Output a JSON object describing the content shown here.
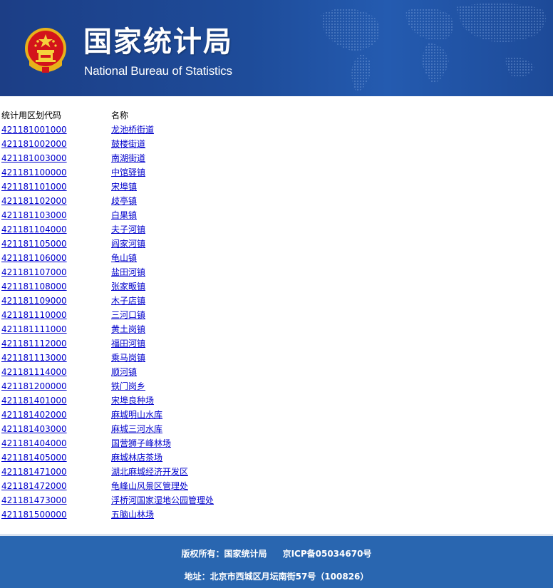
{
  "header": {
    "title_cn": "国家统计局",
    "title_en": "National Bureau of Statistics",
    "emblem_icon": "national-emblem-icon",
    "background_color": "#1e4c9a"
  },
  "table": {
    "code_header": "统计用区划代码",
    "name_header": "名称",
    "link_color": "#0000cc",
    "rows": [
      {
        "code": "421181001000",
        "name": "龙池桥街道"
      },
      {
        "code": "421181002000",
        "name": "鼓楼街道"
      },
      {
        "code": "421181003000",
        "name": "南湖街道"
      },
      {
        "code": "421181100000",
        "name": "中馆驿镇"
      },
      {
        "code": "421181101000",
        "name": "宋埠镇"
      },
      {
        "code": "421181102000",
        "name": "歧亭镇"
      },
      {
        "code": "421181103000",
        "name": "白果镇"
      },
      {
        "code": "421181104000",
        "name": "夫子河镇"
      },
      {
        "code": "421181105000",
        "name": "阎家河镇"
      },
      {
        "code": "421181106000",
        "name": "龟山镇"
      },
      {
        "code": "421181107000",
        "name": "盐田河镇"
      },
      {
        "code": "421181108000",
        "name": "张家畈镇"
      },
      {
        "code": "421181109000",
        "name": "木子店镇"
      },
      {
        "code": "421181110000",
        "name": "三河口镇"
      },
      {
        "code": "421181111000",
        "name": "黄土岗镇"
      },
      {
        "code": "421181112000",
        "name": "福田河镇"
      },
      {
        "code": "421181113000",
        "name": "乘马岗镇"
      },
      {
        "code": "421181114000",
        "name": "顺河镇"
      },
      {
        "code": "421181200000",
        "name": "铁门岗乡"
      },
      {
        "code": "421181401000",
        "name": "宋埠良种场"
      },
      {
        "code": "421181402000",
        "name": "麻城明山水库"
      },
      {
        "code": "421181403000",
        "name": "麻城三河水库"
      },
      {
        "code": "421181404000",
        "name": "国营狮子峰林场"
      },
      {
        "code": "421181405000",
        "name": "麻城林店茶场"
      },
      {
        "code": "421181471000",
        "name": "湖北麻城经济开发区"
      },
      {
        "code": "421181472000",
        "name": "龟峰山风景区管理处"
      },
      {
        "code": "421181473000",
        "name": "浮桥河国家湿地公园管理处"
      },
      {
        "code": "421181500000",
        "name": "五脑山林场"
      }
    ]
  },
  "footer": {
    "copyright": "版权所有：国家统计局",
    "icp": "京ICP备05034670号",
    "address": "地址：北京市西城区月坛南街57号（100826）",
    "background_color": "#2966b0"
  }
}
